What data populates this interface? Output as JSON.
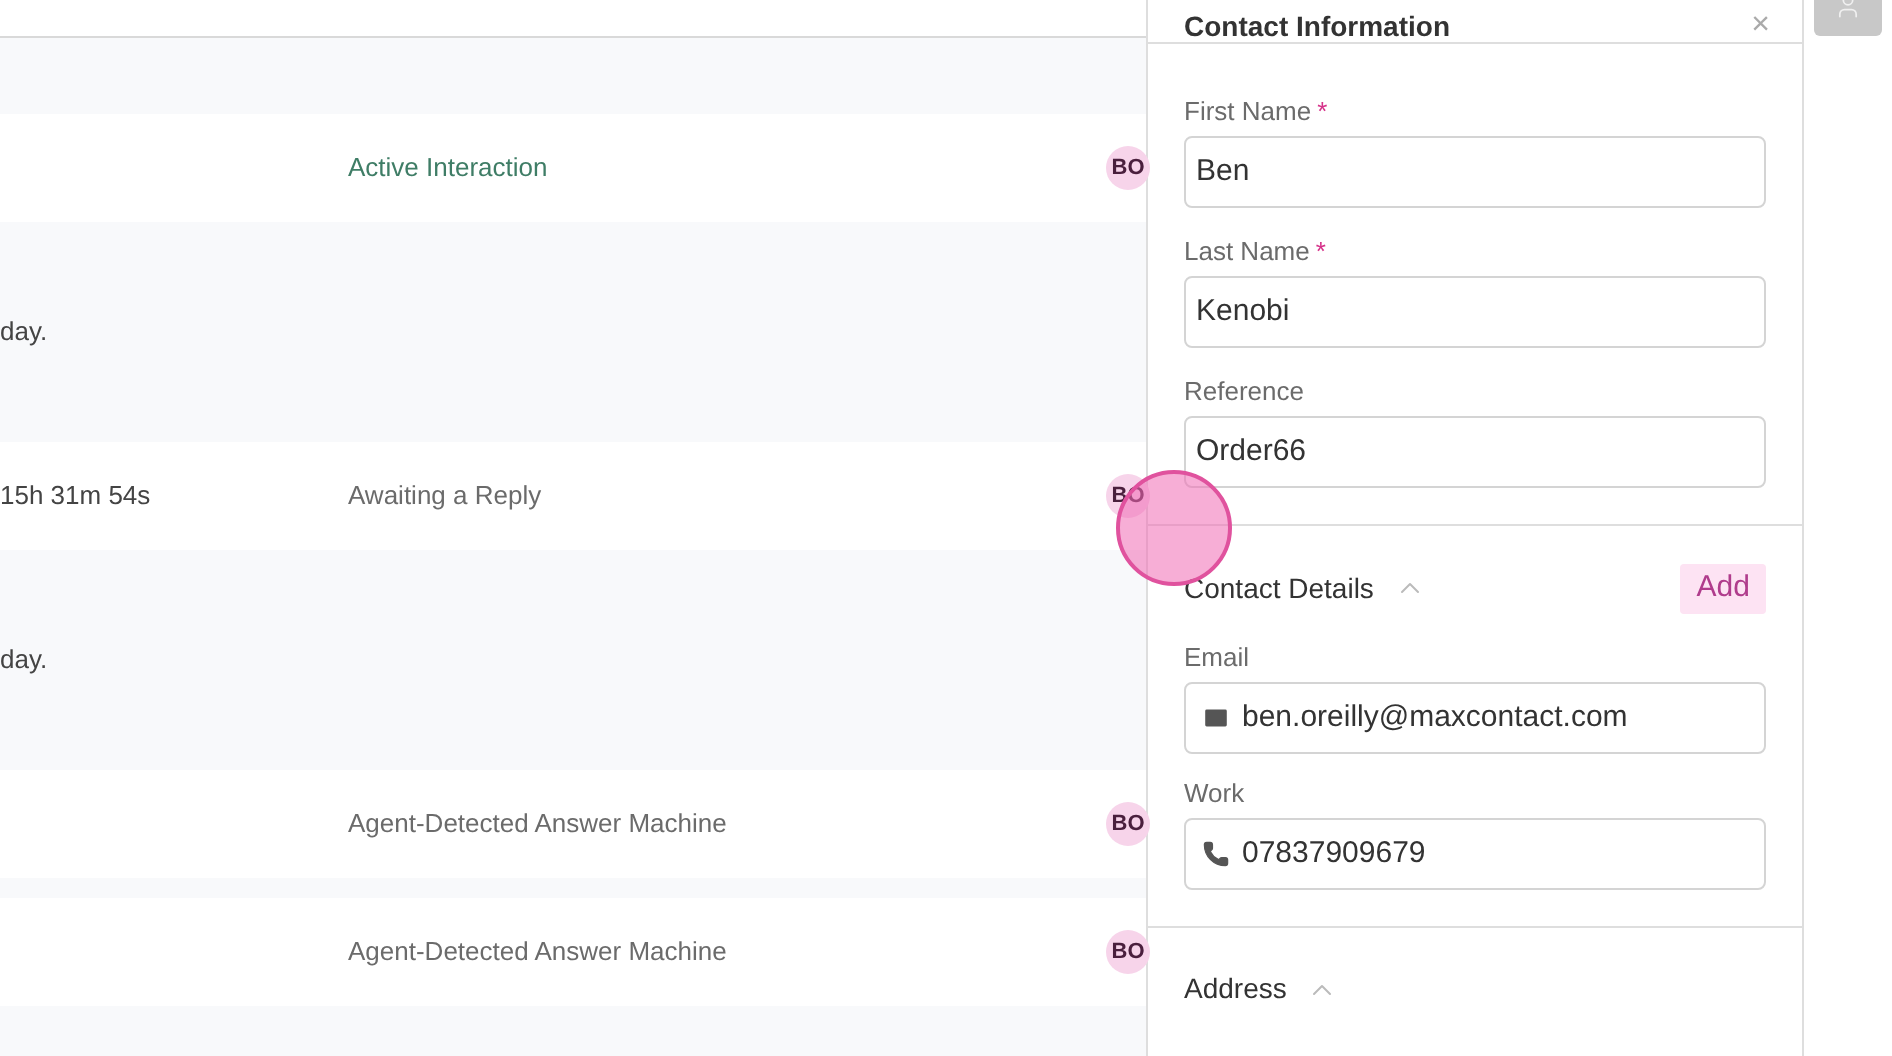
{
  "table": {
    "rows": [
      {
        "kind": "interaction",
        "status": "Active Interaction",
        "color": "#3f7d66",
        "badge": "BO"
      },
      {
        "kind": "note",
        "column_1": "day."
      },
      {
        "kind": "interaction",
        "column_1": "15h 31m 54s",
        "status": "Awaiting a Reply",
        "color": "#6b6b6b",
        "badge": "BO"
      },
      {
        "kind": "note",
        "column_1": "day."
      },
      {
        "kind": "interaction",
        "status": "Agent-Detected Answer Machine",
        "color": "#6b6b6b",
        "badge": "BO"
      },
      {
        "kind": "interaction",
        "status": "Agent-Detected Answer Machine",
        "color": "#6b6b6b",
        "badge": "BO"
      }
    ]
  },
  "panel": {
    "title": "Contact Information",
    "close": "×",
    "fields": [
      {
        "label": "First Name",
        "required_mark": "*",
        "value": "Ben"
      },
      {
        "label": "Last Name",
        "required_mark": "*",
        "value": "Kenobi"
      },
      {
        "label": "Reference",
        "value": "Order66"
      }
    ],
    "contact_details": {
      "title": "Contact Details",
      "expanded": true,
      "add_button": "Add",
      "items": [
        {
          "kind": "email",
          "label": "Email",
          "value": "ben.oreilly@maxcontact.com"
        },
        {
          "kind": "phone",
          "label": "Work",
          "value": "07837909679"
        }
      ]
    },
    "address": {
      "title": "Address",
      "expanded": true
    }
  }
}
